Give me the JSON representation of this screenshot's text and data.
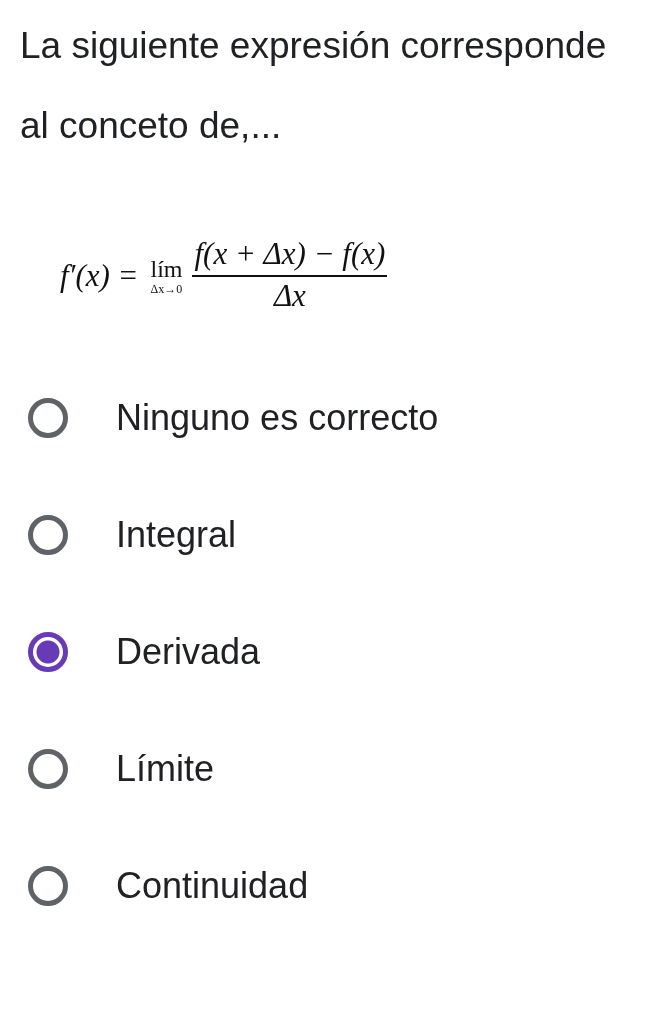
{
  "question": "La siguiente expresión corresponde al conceto de,...",
  "formula": {
    "lhs": "f′(x) =",
    "operator": "lím",
    "limit": "Δx→0",
    "numerator": "f(x + Δx) − f(x)",
    "denominator": "Δx"
  },
  "options": [
    {
      "label": "Ninguno es correcto",
      "selected": false
    },
    {
      "label": "Integral",
      "selected": false
    },
    {
      "label": "Derivada",
      "selected": true
    },
    {
      "label": "Límite",
      "selected": false
    },
    {
      "label": "Continuidad",
      "selected": false
    }
  ]
}
